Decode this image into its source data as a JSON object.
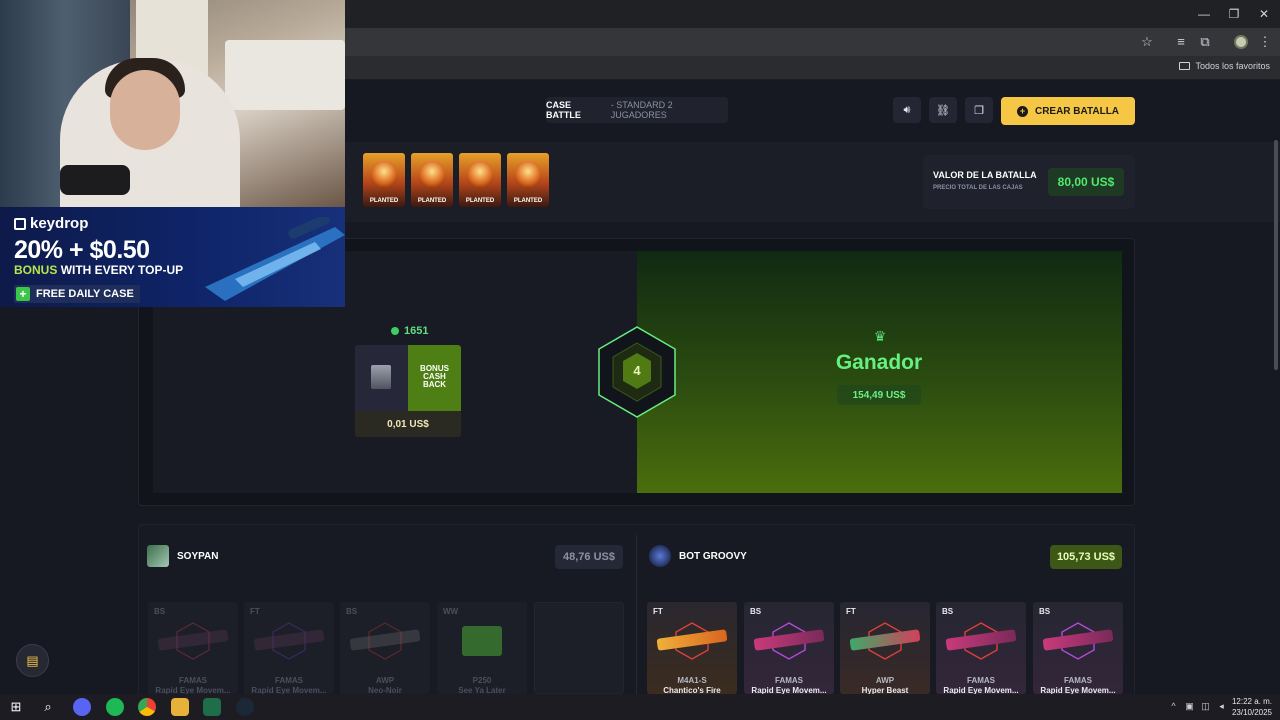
{
  "browser": {
    "bookmarks_label": "Todos los favoritos"
  },
  "header": {
    "battle_title": "CASE BATTLE",
    "battle_subtitle": "- STANDARD 2 JUGADORES",
    "create_label": "CREAR BATALLA"
  },
  "cases": [
    {
      "label": "PLANTED"
    },
    {
      "label": "PLANTED"
    },
    {
      "label": "PLANTED"
    },
    {
      "label": "PLANTED"
    }
  ],
  "battle_value": {
    "title": "VALOR DE LA BATALLA",
    "subtitle": "PRECIO TOTAL DE LAS CAJAS",
    "amount": "80,00 US$"
  },
  "arena": {
    "points": "1651",
    "drop_bonus_line1": "BONUS",
    "drop_bonus_line2": "CASH",
    "drop_bonus_line3": "BACK",
    "drop_price": "0,01 US$",
    "round": "4",
    "winner_label": "Ganador",
    "winner_amount": "154,49 US$"
  },
  "players": [
    {
      "name": "SOYPAN",
      "total": "48,76 US$",
      "items": [
        {
          "wear": "BS",
          "weapon": "FAMAS",
          "skin": "Rapid Eye Movem..."
        },
        {
          "wear": "FT",
          "weapon": "FAMAS",
          "skin": "Rapid Eye Movem..."
        },
        {
          "wear": "BS",
          "weapon": "AWP",
          "skin": "Neo-Noir"
        },
        {
          "wear": "WW",
          "weapon": "P250",
          "skin": "See Ya Later"
        }
      ]
    },
    {
      "name": "BOT GROOVY",
      "total": "105,73 US$",
      "items": [
        {
          "wear": "FT",
          "weapon": "M4A1-S",
          "skin": "Chantico's Fire"
        },
        {
          "wear": "BS",
          "weapon": "FAMAS",
          "skin": "Rapid Eye Movem..."
        },
        {
          "wear": "FT",
          "weapon": "AWP",
          "skin": "Hyper Beast"
        },
        {
          "wear": "BS",
          "weapon": "FAMAS",
          "skin": "Rapid Eye Movem..."
        },
        {
          "wear": "BS",
          "weapon": "FAMAS",
          "skin": "Rapid Eye Movem..."
        }
      ]
    }
  ],
  "ad": {
    "brand": "keydrop",
    "headline": "20% + $0.50",
    "sub_highlight": "BONUS",
    "sub_rest": "WITH EVERY TOP-UP",
    "cta": "FREE DAILY CASE"
  },
  "taskbar": {
    "time": "12:22 a. m.",
    "date": "23/10/2025"
  },
  "colors": {
    "accent": "#f6c744",
    "win_green": "#66f07f",
    "panel_bg": "#181a24"
  }
}
